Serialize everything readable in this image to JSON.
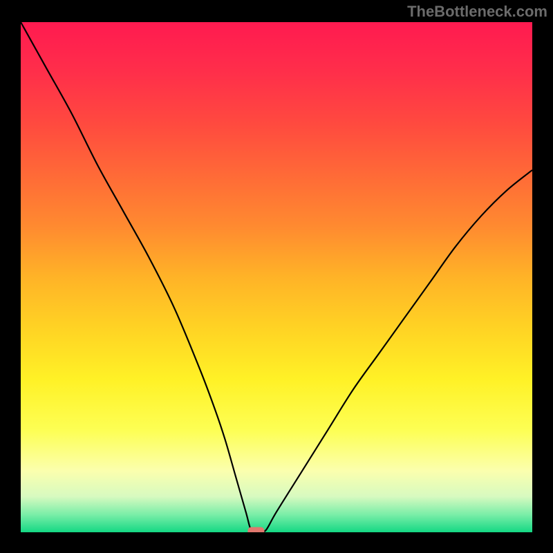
{
  "attribution": "TheBottleneck.com",
  "colors": {
    "frame": "#000000",
    "curve": "#000000",
    "marker_fill": "#e0786e",
    "attribution_text": "#6b6b6b",
    "gradient_stops": [
      {
        "offset": 0.0,
        "color": "#ff1a50"
      },
      {
        "offset": 0.1,
        "color": "#ff2f4a"
      },
      {
        "offset": 0.2,
        "color": "#ff4a3f"
      },
      {
        "offset": 0.3,
        "color": "#ff6a37"
      },
      {
        "offset": 0.4,
        "color": "#ff8a30"
      },
      {
        "offset": 0.5,
        "color": "#ffb327"
      },
      {
        "offset": 0.6,
        "color": "#ffd324"
      },
      {
        "offset": 0.7,
        "color": "#fff126"
      },
      {
        "offset": 0.8,
        "color": "#fdff54"
      },
      {
        "offset": 0.88,
        "color": "#fbffae"
      },
      {
        "offset": 0.93,
        "color": "#d7fac0"
      },
      {
        "offset": 0.965,
        "color": "#7beea8"
      },
      {
        "offset": 1.0,
        "color": "#14d884"
      }
    ]
  },
  "chart_data": {
    "type": "line",
    "title": "",
    "xlabel": "",
    "ylabel": "",
    "xlim": [
      0,
      100
    ],
    "ylim": [
      0,
      100
    ],
    "grid": false,
    "legend": false,
    "comment": "V-shaped bottleneck curve: y is the bottleneck percentage. Minimum ≈0 at x≈46.",
    "x": [
      0,
      5,
      10,
      15,
      20,
      25,
      30,
      35,
      38,
      40,
      42,
      44,
      45,
      46,
      47,
      48,
      50,
      55,
      60,
      65,
      70,
      75,
      80,
      85,
      90,
      95,
      100
    ],
    "y": [
      100,
      91,
      82,
      72,
      63,
      54,
      44,
      32,
      24,
      18,
      11,
      4,
      0.5,
      0.2,
      0.2,
      0.5,
      4,
      12,
      20,
      28,
      35,
      42,
      49,
      56,
      62,
      67,
      71
    ],
    "marker": {
      "x": 46,
      "y": 0.2,
      "shape": "rounded-rect"
    }
  }
}
